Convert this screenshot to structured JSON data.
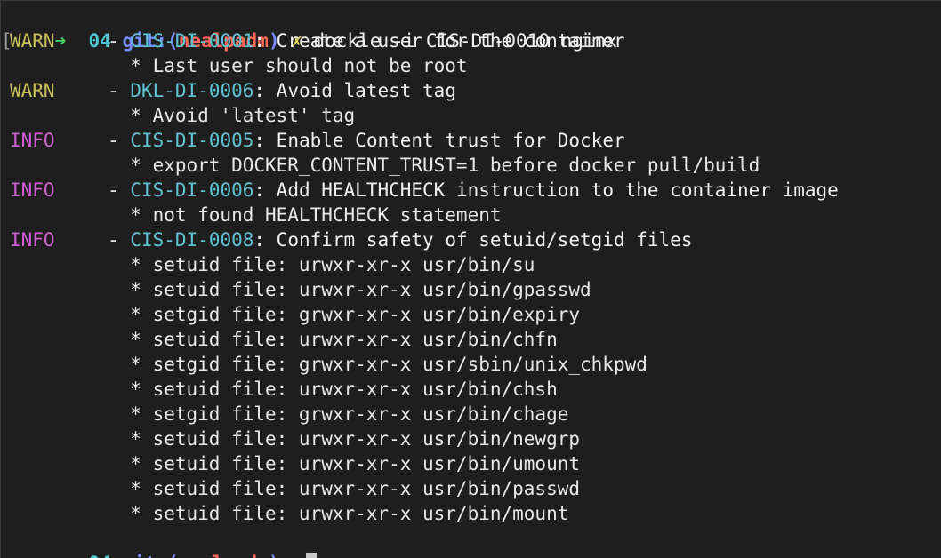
{
  "prompt": {
    "bracket": "[",
    "arrow": "➜",
    "dir": "04",
    "git_prefix": "git:(",
    "branch": "nealpadm",
    "git_suffix": ")",
    "dirty": "✗"
  },
  "command": "dockle -i CIS-DI-0010 nginx",
  "findings": [
    {
      "level": "WARN",
      "code": "CIS-DI-0001",
      "title": ": Create a user for the container",
      "details": [
        "* Last user should not be root"
      ]
    },
    {
      "level": "WARN",
      "code": "DKL-DI-0006",
      "title": ": Avoid latest tag",
      "details": [
        "* Avoid 'latest' tag"
      ]
    },
    {
      "level": "INFO",
      "code": "CIS-DI-0005",
      "title": ": Enable Content trust for Docker",
      "details": [
        "* export DOCKER_CONTENT_TRUST=1 before docker pull/build"
      ]
    },
    {
      "level": "INFO",
      "code": "CIS-DI-0006",
      "title": ": Add HEALTHCHECK instruction to the container image",
      "details": [
        "* not found HEALTHCHECK statement"
      ]
    },
    {
      "level": "INFO",
      "code": "CIS-DI-0008",
      "title": ": Confirm safety of setuid/setgid files",
      "details": [
        "* setuid file: urwxr-xr-x usr/bin/su",
        "* setuid file: urwxr-xr-x usr/bin/gpasswd",
        "* setgid file: grwxr-xr-x usr/bin/expiry",
        "* setuid file: urwxr-xr-x usr/bin/chfn",
        "* setgid file: grwxr-xr-x usr/sbin/unix_chkpwd",
        "* setuid file: urwxr-xr-x usr/bin/chsh",
        "* setgid file: grwxr-xr-x usr/bin/chage",
        "* setuid file: urwxr-xr-x usr/bin/newgrp",
        "* setuid file: urwxr-xr-x usr/bin/umount",
        "* setuid file: urwxr-xr-x usr/bin/passwd",
        "* setuid file: urwxr-xr-x usr/bin/mount"
      ]
    }
  ],
  "dash": "-",
  "colors": {
    "background": "#1e1e1e",
    "arrow": "#3fd46b",
    "dir": "#4fc6d6",
    "git": "#7b8cff",
    "branch": "#ff6b5a",
    "dirty": "#e0d25a",
    "warn": "#c9c25a",
    "info": "#d25fd8",
    "code": "#5fc4d4"
  }
}
